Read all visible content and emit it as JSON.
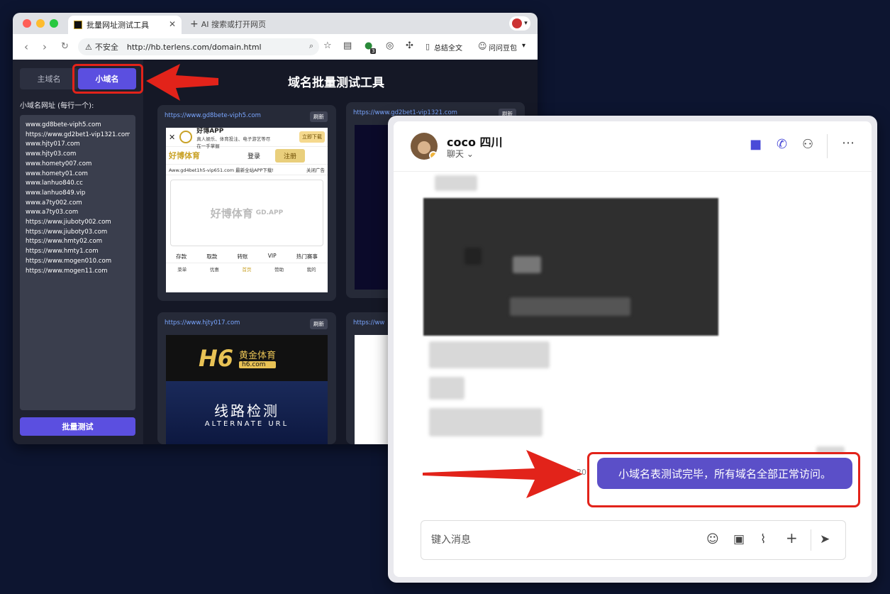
{
  "browser": {
    "tab_title": "批量网址测试工具",
    "new_tab_label": "AI 搜索或打开网页",
    "insecure_label": "不安全",
    "url": "http://hb.terlens.com/domain.html",
    "toolbar_summarize": "总结全文",
    "toolbar_ask": "问问豆包",
    "badge_count": "3"
  },
  "page": {
    "title": "域名批量测试工具",
    "tabs": [
      {
        "label": "主域名",
        "active": false
      },
      {
        "label": "小域名",
        "active": true
      }
    ],
    "list_label": "小域名网址 (每行一个):",
    "domains": [
      "www.gd8bete-viph5.com",
      "https://www.gd2bet1-vip1321.com",
      "www.hjty017.com",
      "www.hjty03.com",
      "www.homety007.com",
      "www.homety01.com",
      "www.lanhuo840.cc",
      "www.lanhuo849.vip",
      "www.a7ty002.com",
      "www.a7ty03.com",
      "https://www.jiuboty002.com",
      "https://www.jiuboty03.com",
      "https://www.hmty02.com",
      "https://www.hmty1.com",
      "https://www.mogen010.com",
      "https://www.mogen11.com"
    ],
    "batch_button": "批量测试",
    "refresh_label": "刷新",
    "cards": [
      {
        "url": "https://www.gd8bete-viph5.com"
      },
      {
        "url": "https://www.gd2bet1-vip1321.com"
      },
      {
        "url": "https://www.hjty017.com"
      },
      {
        "url": "https://ww"
      }
    ],
    "card1": {
      "app_name": "好博APP",
      "app_desc": "真人娱乐、体育投注、电子游艺等尽在一手掌握",
      "download": "立即下载",
      "brand": "好博体育",
      "brand_sub": "GD.APP",
      "login": "登录",
      "register": "注册",
      "marquee": "Aww.gd4bet1h5-vip651.com 最新全站APP下载!",
      "close_ad": "关闭广告",
      "quick": [
        "存款",
        "取款",
        "转账",
        "VIP",
        "热门赛事"
      ],
      "nav": [
        "菜单",
        "优惠",
        "首页",
        "赞助",
        "我的"
      ]
    },
    "card3": {
      "brand": "H6",
      "brand_cn": "黄金体育",
      "brand_domain": "h6.com",
      "line_check": "线路检测",
      "alt_url": "ALTERNATE URL"
    }
  },
  "chat": {
    "name": "coco 四川",
    "subtitle": "聊天",
    "message": "小域名表测试完毕，所有域名全部正常访问。",
    "time_fragment": "20",
    "input_placeholder": "键入消息"
  },
  "colors": {
    "accent": "#5b4fe0",
    "highlight": "#e2231a",
    "chat_bubble": "#5b4fc8"
  }
}
